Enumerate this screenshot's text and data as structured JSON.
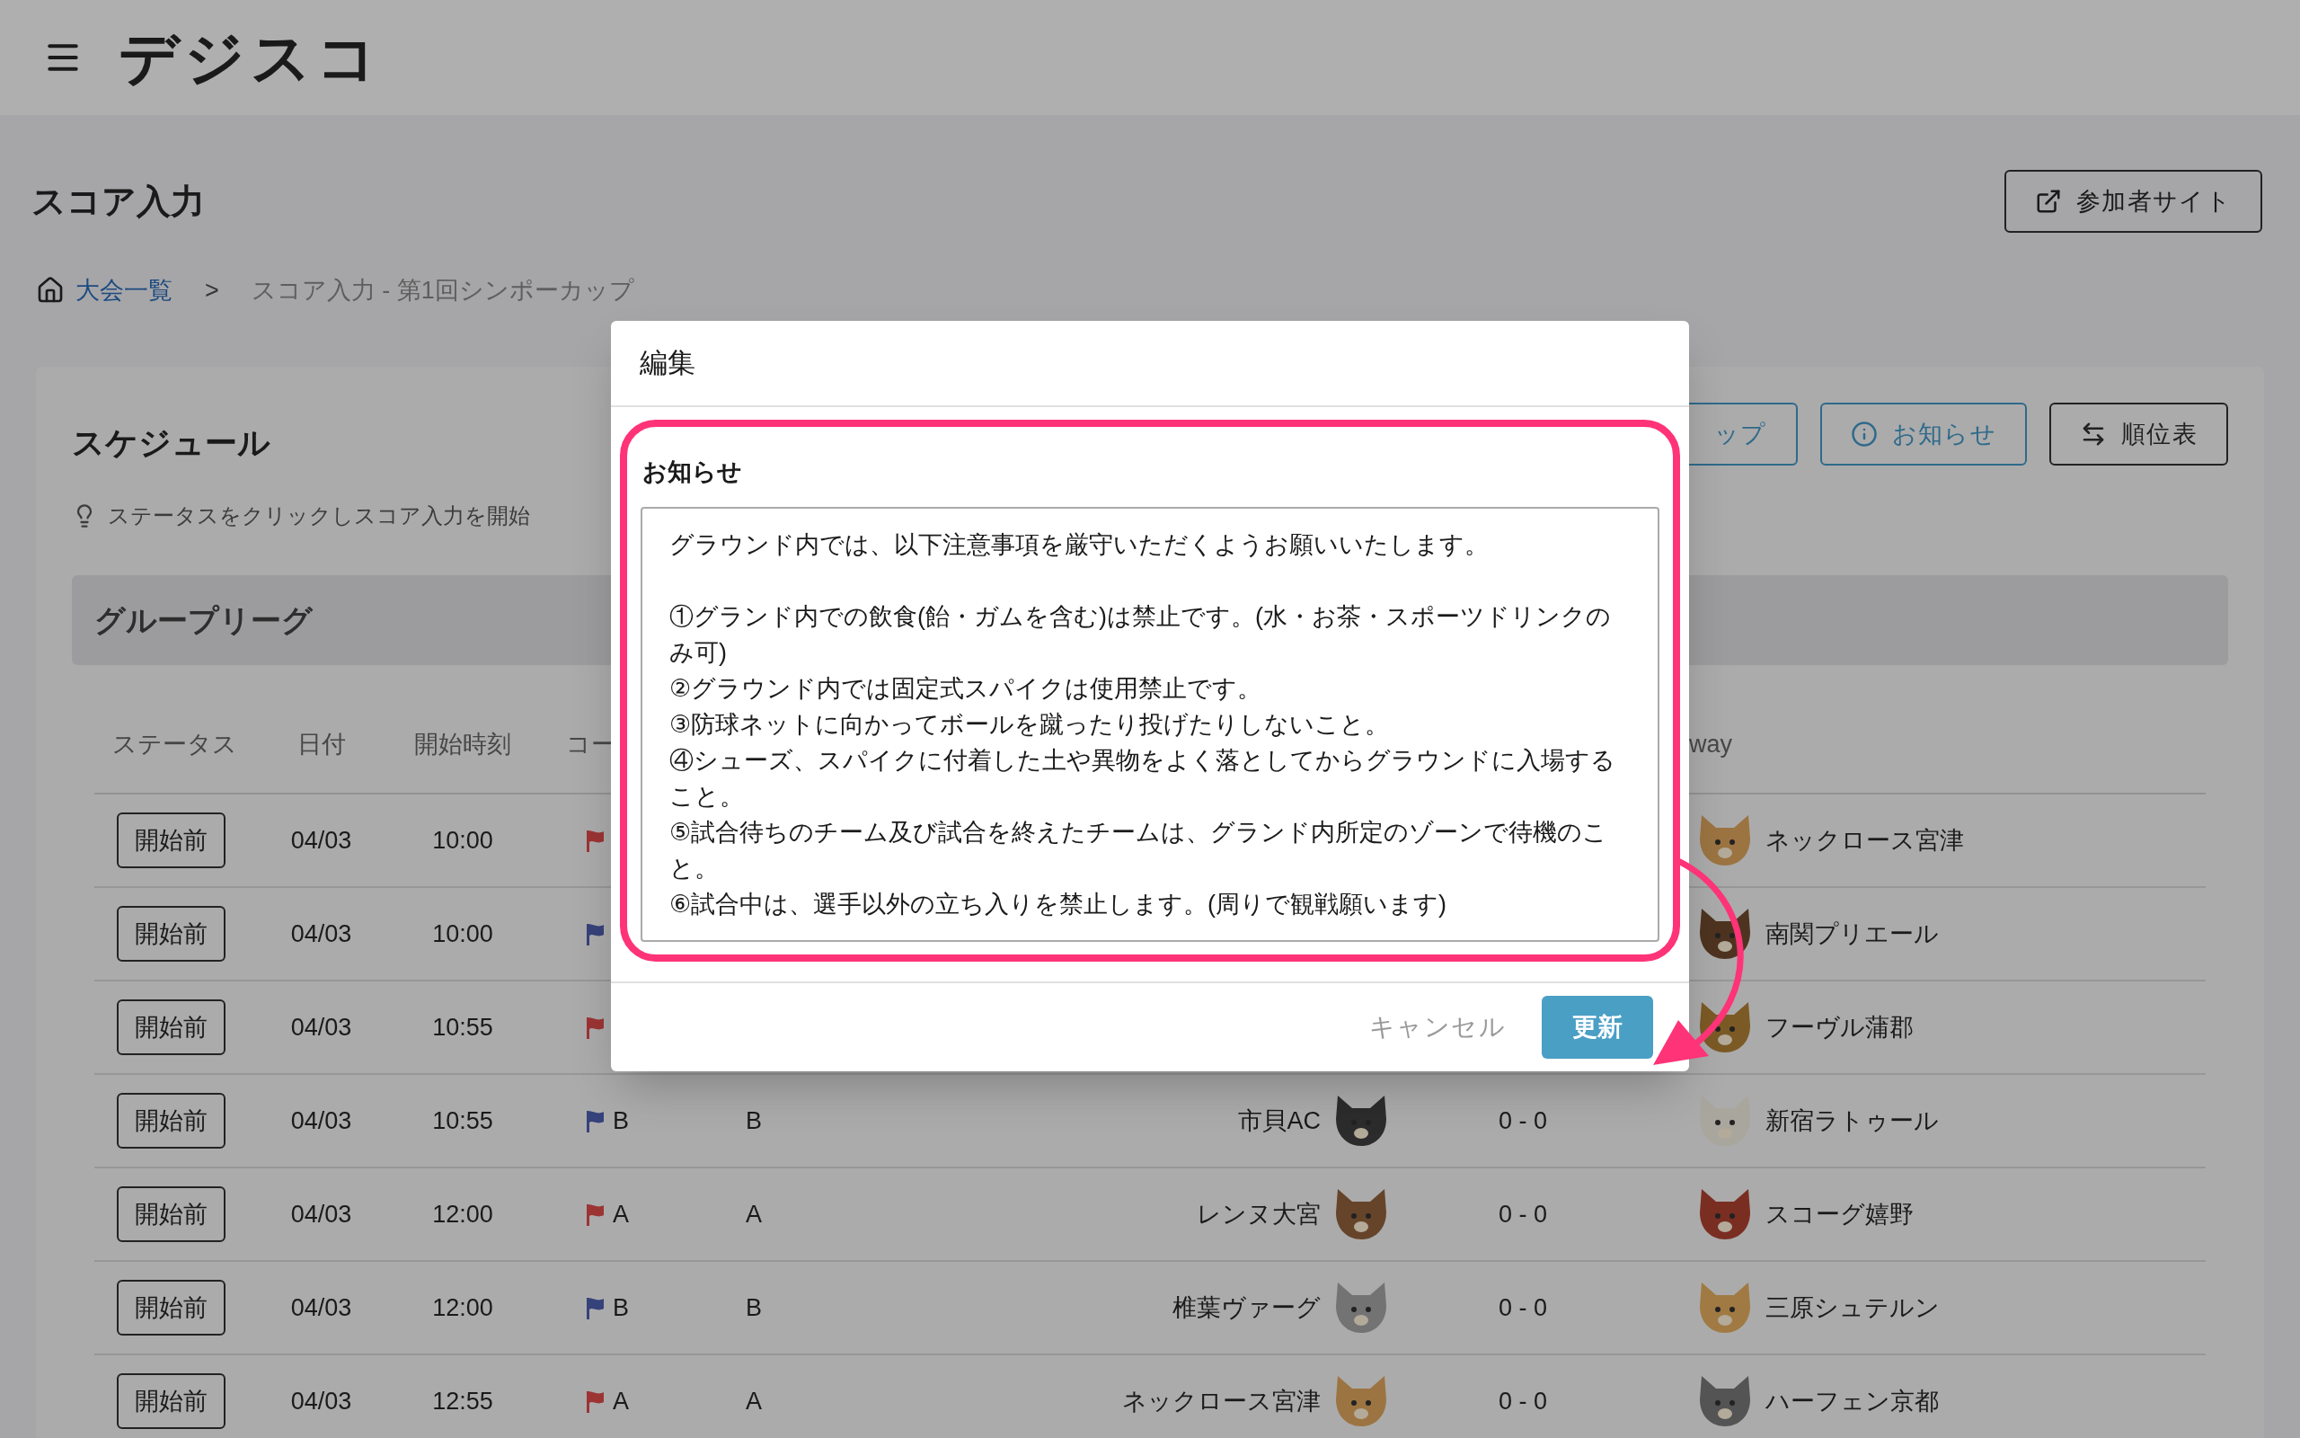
{
  "header": {
    "logo": "デジスコ"
  },
  "page": {
    "title": "スコア入力",
    "participant_site_button": "参加者サイト"
  },
  "breadcrumb": [
    {
      "label": "大会一覧",
      "kind": "link"
    },
    {
      "label": ">",
      "kind": "separator"
    },
    {
      "label": "スコア入力 - 第1回シンポーカップ",
      "kind": "current"
    }
  ],
  "schedule": {
    "title": "スケジュール",
    "hint": "ステータスをクリックしスコア入力を開始",
    "actions": [
      {
        "label": "ップ",
        "kind": "partial"
      },
      {
        "label": "お知らせ",
        "kind": "info"
      },
      {
        "label": "順位表",
        "kind": "swap"
      }
    ],
    "group_title": "グループリーグ",
    "columns": [
      "ステータス",
      "日付",
      "開始時刻",
      "コー",
      "way"
    ],
    "rows": [
      {
        "status": "開始前",
        "date": "04/03",
        "time": "10:00",
        "court": {
          "color": "#9c3434"
        },
        "away": {
          "name": "ネックロース宮津",
          "color": "#9c7442"
        }
      },
      {
        "status": "開始前",
        "date": "04/03",
        "time": "10:00",
        "court": {
          "color": "#36427a"
        },
        "away": {
          "name": "南関プリエール",
          "color": "#4e3420"
        }
      },
      {
        "status": "開始前",
        "date": "04/03",
        "time": "10:55",
        "court": {
          "color": "#9c3434"
        },
        "away": {
          "name": "フーヴル蒲郡",
          "color": "#7c5a26"
        }
      },
      {
        "status": "開始前",
        "date": "04/03",
        "time": "10:55",
        "court": {
          "label": "B",
          "color": "#36427a"
        },
        "group": "B",
        "home": {
          "name": "市貝AC",
          "color": "#2c2c2c"
        },
        "score": "0 - 0",
        "away": {
          "name": "新宿ラトゥール",
          "color": "#a9a69e"
        }
      },
      {
        "status": "開始前",
        "date": "04/03",
        "time": "12:00",
        "court": {
          "label": "A",
          "color": "#9c3434"
        },
        "group": "A",
        "home": {
          "name": "レンヌ大宮",
          "color": "#66442a"
        },
        "score": "0 - 0",
        "away": {
          "name": "スコーグ嬉野",
          "color": "#7a2e22"
        }
      },
      {
        "status": "開始前",
        "date": "04/03",
        "time": "12:00",
        "court": {
          "label": "B",
          "color": "#36427a"
        },
        "group": "B",
        "home": {
          "name": "椎葉ヴァーグ",
          "color": "#737373"
        },
        "score": "0 - 0",
        "away": {
          "name": "三原シュテルン",
          "color": "#a07a42"
        }
      },
      {
        "status": "開始前",
        "date": "04/03",
        "time": "12:55",
        "court": {
          "label": "A",
          "color": "#9c3434"
        },
        "group": "A",
        "home": {
          "name": "ネックロース宮津",
          "color": "#9c7442"
        },
        "score": "0 - 0",
        "away": {
          "name": "ハーフェン京都",
          "color": "#545454"
        }
      }
    ]
  },
  "dialog": {
    "title": "編集",
    "field_label": "お知らせ",
    "field_value": "グラウンド内では、以下注意事項を厳守いただくようお願いいたします。\n\n①グランド内での飲食(飴・ガムを含む)は禁止です。(水・お茶・スポーツドリンクのみ可)\n②グラウンド内では固定式スパイクは使用禁止です。\n③防球ネットに向かってボールを蹴ったり投げたりしないこと。\n④シューズ、スパイクに付着した土や異物をよく落としてからグラウンドに入場すること。\n⑤試合待ちのチーム及び試合を終えたチームは、グランド内所定のゾーンで待機のこと。\n⑥試合中は、選手以外の立ち入りを禁止します。(周りで観戦願います)",
    "cancel": "キャンセル",
    "submit": "更新"
  }
}
